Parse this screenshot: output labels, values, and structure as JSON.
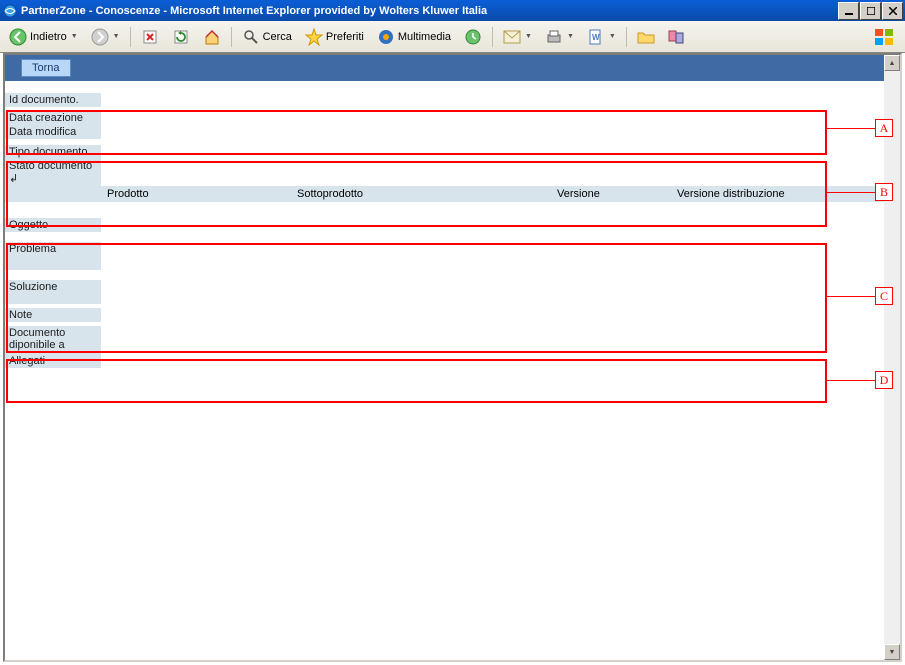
{
  "window": {
    "title": "PartnerZone - Conoscenze - Microsoft Internet Explorer provided by Wolters Kluwer Italia"
  },
  "toolbar": {
    "back": "Indietro",
    "search": "Cerca",
    "favorites": "Preferiti",
    "media": "Multimedia"
  },
  "page": {
    "return_btn": "Torna",
    "labels": {
      "id": "Id documento.",
      "created": "Data creazione",
      "modified": "Data modifica",
      "type": "Tipo documento",
      "state": "Stato documento",
      "subject": "Oggetto",
      "problem": "Problema",
      "solution": "Soluzione",
      "notes": "Note",
      "available": "Documento diponibile a",
      "attachments": "Allegati"
    },
    "product_columns": {
      "product": "Prodotto",
      "subproduct": "Sottoprodotto",
      "version": "Versione",
      "dist_version": "Versione distribuzione"
    }
  },
  "callouts": {
    "a": "A",
    "b": "B",
    "c": "C",
    "d": "D"
  }
}
